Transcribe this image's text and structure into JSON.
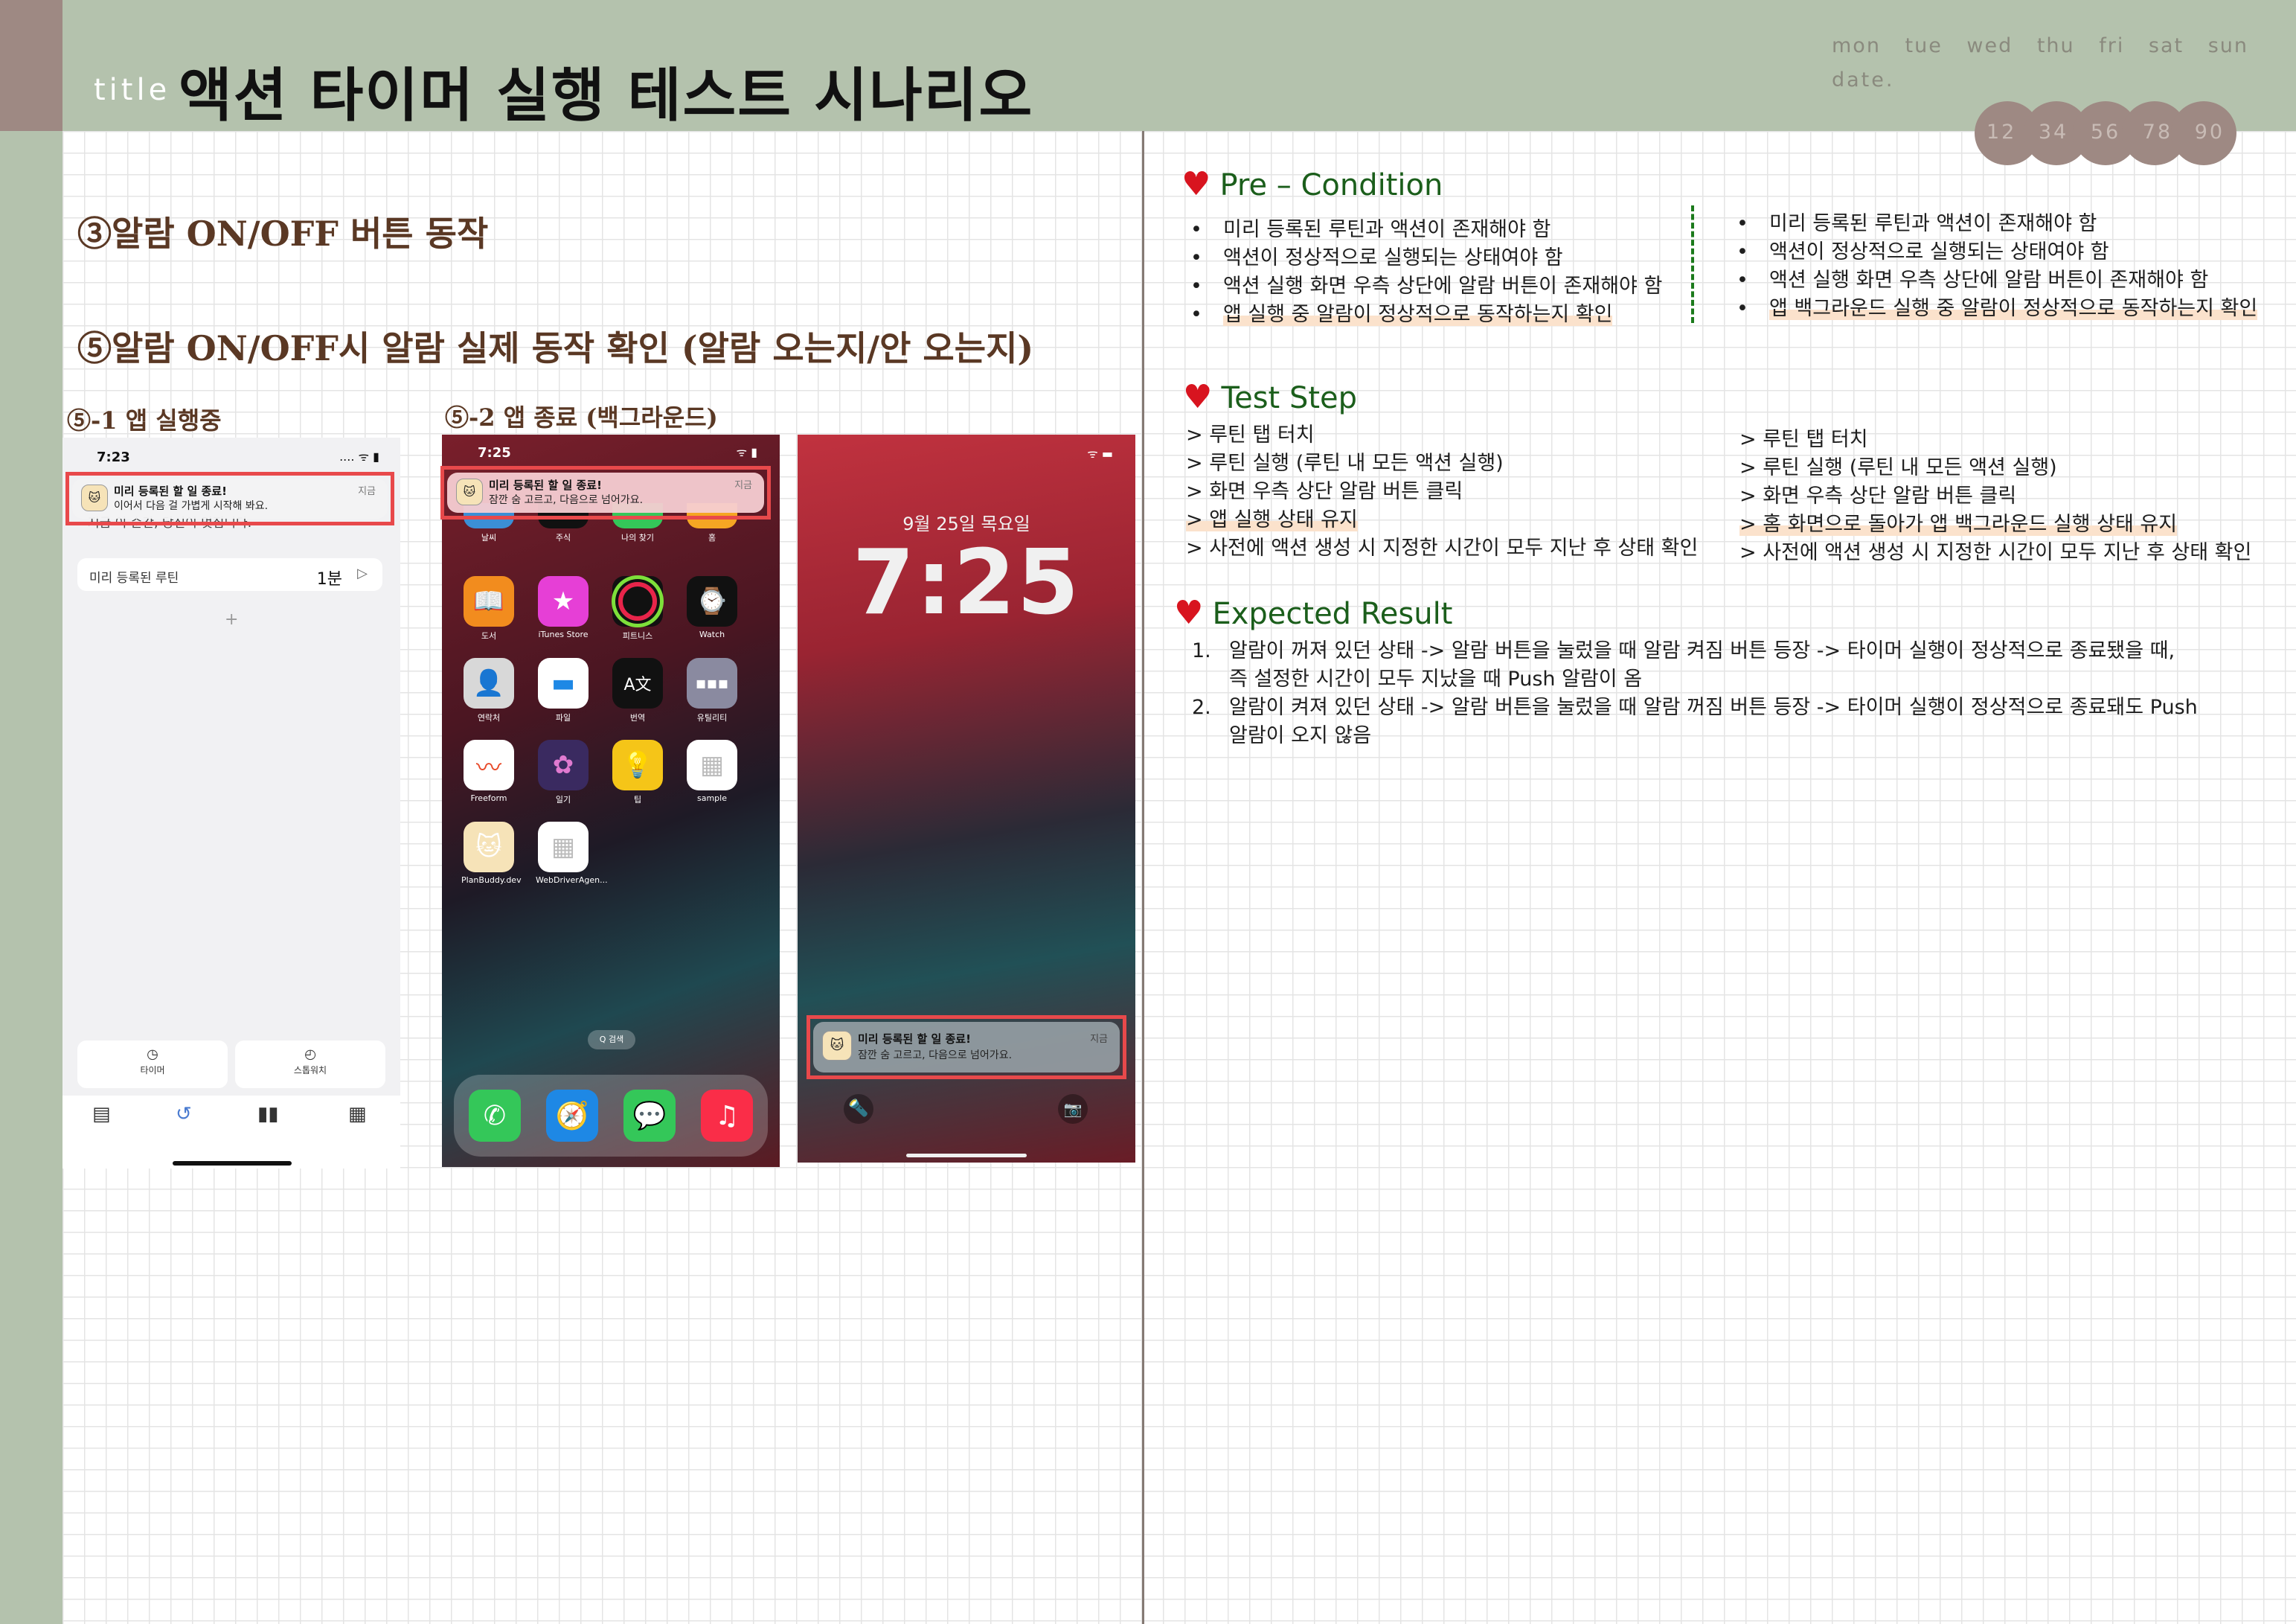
{
  "header": {
    "title_label": "title",
    "title": "액션 타이머 실행 테스트 시나리오",
    "days": "mon tue wed thu fri sat sun",
    "date_label": "date.",
    "date_digits": "12 34 56 78 90"
  },
  "left": {
    "heading_3": "③알람 ON/OFF 버튼 동작",
    "heading_5": "⑤알람 ON/OFF시 알람 실제 동작 확인 (알람 오는지/안 오는지)",
    "sub_1": "⑤-1 앱 실행중",
    "sub_2": "⑤-2 앱 종료 (백그라운드)"
  },
  "notification": {
    "title": "미리 등록된 할 일 종료!",
    "body_foreground": "이어서 다음 걸 가볍게 시작해 봐요.",
    "body_background": "잠깐 숨 고르고, 다음으로 넘어가요.",
    "time": "지금"
  },
  "phone1": {
    "time": "7:23",
    "status": "....",
    "covered_text": "지금 이 순간, 당신이 멋집니다.",
    "routine_label": "미리 등록된 루틴",
    "routine_duration": "1분",
    "add_symbol": "+",
    "buttons": [
      {
        "icon": "timer-icon",
        "label": "타이머"
      },
      {
        "icon": "stopwatch-icon",
        "label": "스톱워치"
      }
    ],
    "tabs": [
      "calendar-icon",
      "history-icon",
      "stats-icon",
      "notes-icon"
    ]
  },
  "phone2": {
    "time": "7:25",
    "top_row": [
      "날씨",
      "주식",
      "나의 찾기",
      "홈"
    ],
    "apps": [
      {
        "name": "도서",
        "icon": "books-icon",
        "color": "#f28c1e"
      },
      {
        "name": "iTunes Store",
        "icon": "itunes-store-icon",
        "color": "#e63fd6"
      },
      {
        "name": "피트니스",
        "icon": "fitness-icon",
        "color": "#111111"
      },
      {
        "name": "Watch",
        "icon": "watch-icon",
        "color": "#111111"
      },
      {
        "name": "연락처",
        "icon": "contacts-icon",
        "color": "#d8d8d8"
      },
      {
        "name": "파일",
        "icon": "files-icon",
        "color": "#ffffff"
      },
      {
        "name": "번역",
        "icon": "translate-icon",
        "color": "#111111"
      },
      {
        "name": "유틸리티",
        "icon": "utilities-icon",
        "color": "#8a8aa0"
      },
      {
        "name": "Freeform",
        "icon": "freeform-icon",
        "color": "#ffffff"
      },
      {
        "name": "일기",
        "icon": "journal-icon",
        "color": "#3a2a60"
      },
      {
        "name": "팁",
        "icon": "tips-icon",
        "color": "#f5c518"
      },
      {
        "name": "sample",
        "icon": "sample-icon",
        "color": "#ffffff"
      },
      {
        "name": "PlanBuddy.dev",
        "icon": "planbuddy-icon",
        "color": "#f6e3b8"
      },
      {
        "name": "WebDriverAgen...",
        "icon": "webdriveragent-icon",
        "color": "#ffffff"
      }
    ],
    "search_label": "Q 검색",
    "dock": [
      {
        "icon": "phone-icon",
        "color": "#34c759"
      },
      {
        "icon": "safari-icon",
        "color": "#1e88e5"
      },
      {
        "icon": "messages-icon",
        "color": "#34c759"
      },
      {
        "icon": "music-icon",
        "color": "#fa2d48"
      }
    ]
  },
  "phone3": {
    "date": "9월 25일 목요일",
    "clock": "7:25"
  },
  "pre_condition": {
    "title": "Pre – Condition",
    "col1": [
      "미리 등록된 루틴과 액션이 존재해야 함",
      "액션이 정상적으로 실행되는 상태여야 함",
      "액션 실행 화면 우측 상단에 알람 버튼이 존재해야 함",
      "앱 실행 중 알람이 정상적으로 동작하는지 확인"
    ],
    "col2": [
      "미리 등록된 루틴과 액션이 존재해야 함",
      "액션이 정상적으로 실행되는 상태여야 함",
      "액션 실행 화면 우측 상단에 알람 버튼이 존재해야 함",
      "앱 백그라운드 실행 중 알람이 정상적으로 동작하는지 확인"
    ]
  },
  "test_step": {
    "title": "Test Step",
    "col1": [
      "> 루틴 탭 터치",
      "> 루틴 실행 (루틴 내 모든 액션 실행)",
      "> 화면 우측 상단 알람 버튼 클릭",
      "> 앱 실행 상태 유지",
      "> 사전에 액션 생성 시 지정한 시간이 모두 지난 후 상태 확인"
    ],
    "col2": [
      "> 루틴 탭 터치",
      "> 루틴 실행 (루틴 내 모든 액션 실행)",
      "> 화면 우측 상단 알람 버튼 클릭",
      "> 홈 화면으로 돌아가 앱 백그라운드 실행 상태 유지",
      "> 사전에 액션 생성 시 지정한 시간이 모두 지난 후 상태 확인"
    ]
  },
  "expected_result": {
    "title": "Expected Result",
    "items": [
      {
        "num": "1.",
        "line1": "알람이 꺼져 있던 상태 -> 알람 버튼을 눌렀을 때 알람 켜짐 버튼 등장 -> 타이머 실행이 정상적으로 종료됐을 때,",
        "line2": "즉 설정한 시간이 모두 지났을 때 Push 알람이 옴"
      },
      {
        "num": "2.",
        "line1": "알람이 켜져 있던 상태 -> 알람 버튼을 눌렀을 때 알람 꺼짐 버튼 등장 -> 타이머 실행이 정상적으로 종료돼도 Push",
        "line2": "알람이 오지 않음"
      }
    ]
  }
}
